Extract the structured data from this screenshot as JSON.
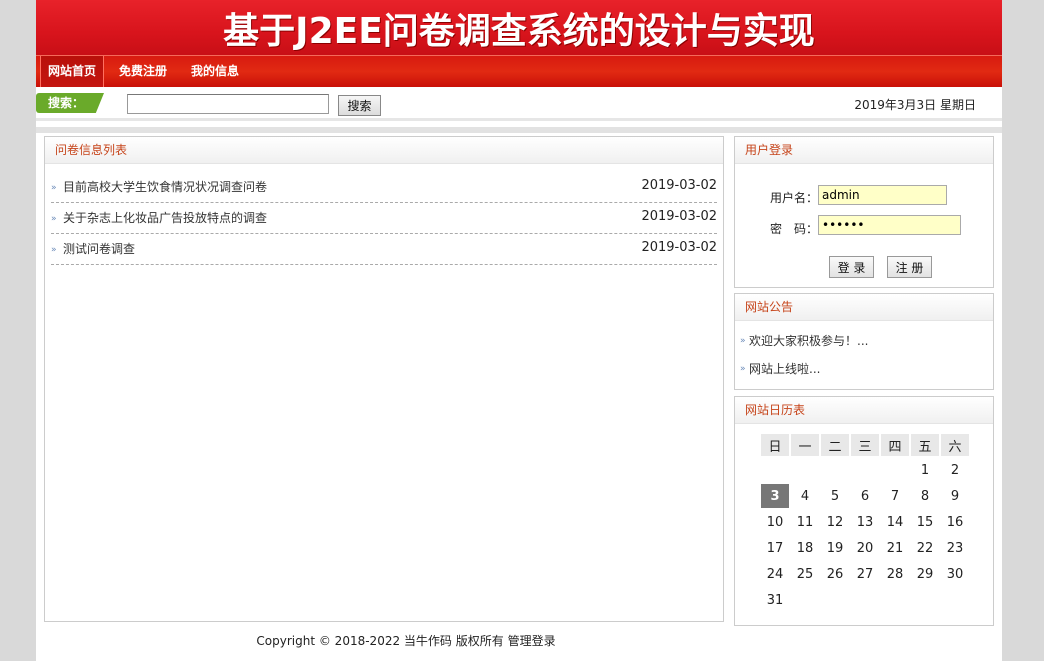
{
  "banner": {
    "title": "基于J2EE问卷调查系统的设计与实现"
  },
  "nav": {
    "items": [
      "网站首页",
      "免费注册",
      "我的信息"
    ]
  },
  "search": {
    "tag": "搜索：",
    "value": "",
    "placeholder": "",
    "button": "搜索"
  },
  "date_text": "2019年3月3日 星期日",
  "surveys": {
    "heading": "问卷信息列表",
    "items": [
      {
        "title": "目前高校大学生饮食情况状况调查问卷",
        "date": "2019-03-02"
      },
      {
        "title": "关于杂志上化妆品广告投放特点的调查",
        "date": "2019-03-02"
      },
      {
        "title": "测试问卷调查",
        "date": "2019-03-02"
      }
    ]
  },
  "login": {
    "heading": "用户登录",
    "username_label": "用户名：",
    "username_value": "admin",
    "password_label": "密　码：",
    "password_value": "••••••",
    "login_button": "登 录",
    "register_button": "注 册"
  },
  "notice": {
    "heading": "网站公告",
    "items": [
      "欢迎大家积极参与！...",
      "网站上线啦..."
    ]
  },
  "calendar": {
    "heading": "网站日历表",
    "weekdays": [
      "日",
      "一",
      "二",
      "三",
      "四",
      "五",
      "六"
    ],
    "weeks": [
      [
        "",
        "",
        "",
        "",
        "",
        "1",
        "2"
      ],
      [
        "3",
        "4",
        "5",
        "6",
        "7",
        "8",
        "9"
      ],
      [
        "10",
        "11",
        "12",
        "13",
        "14",
        "15",
        "16"
      ],
      [
        "17",
        "18",
        "19",
        "20",
        "21",
        "22",
        "23"
      ],
      [
        "24",
        "25",
        "26",
        "27",
        "28",
        "29",
        "30"
      ],
      [
        "31",
        "",
        "",
        "",
        "",
        "",
        ""
      ]
    ],
    "today": "3"
  },
  "footer": {
    "copyright": "Copyright © 2018-2022 当牛作码 版权所有",
    "admin_link": "管理登录"
  },
  "colors": {
    "brand_red": "#e1201a",
    "search_green": "#6aaa2a",
    "heading_orange": "#c6441a",
    "input_yellow": "#ffffc8"
  }
}
